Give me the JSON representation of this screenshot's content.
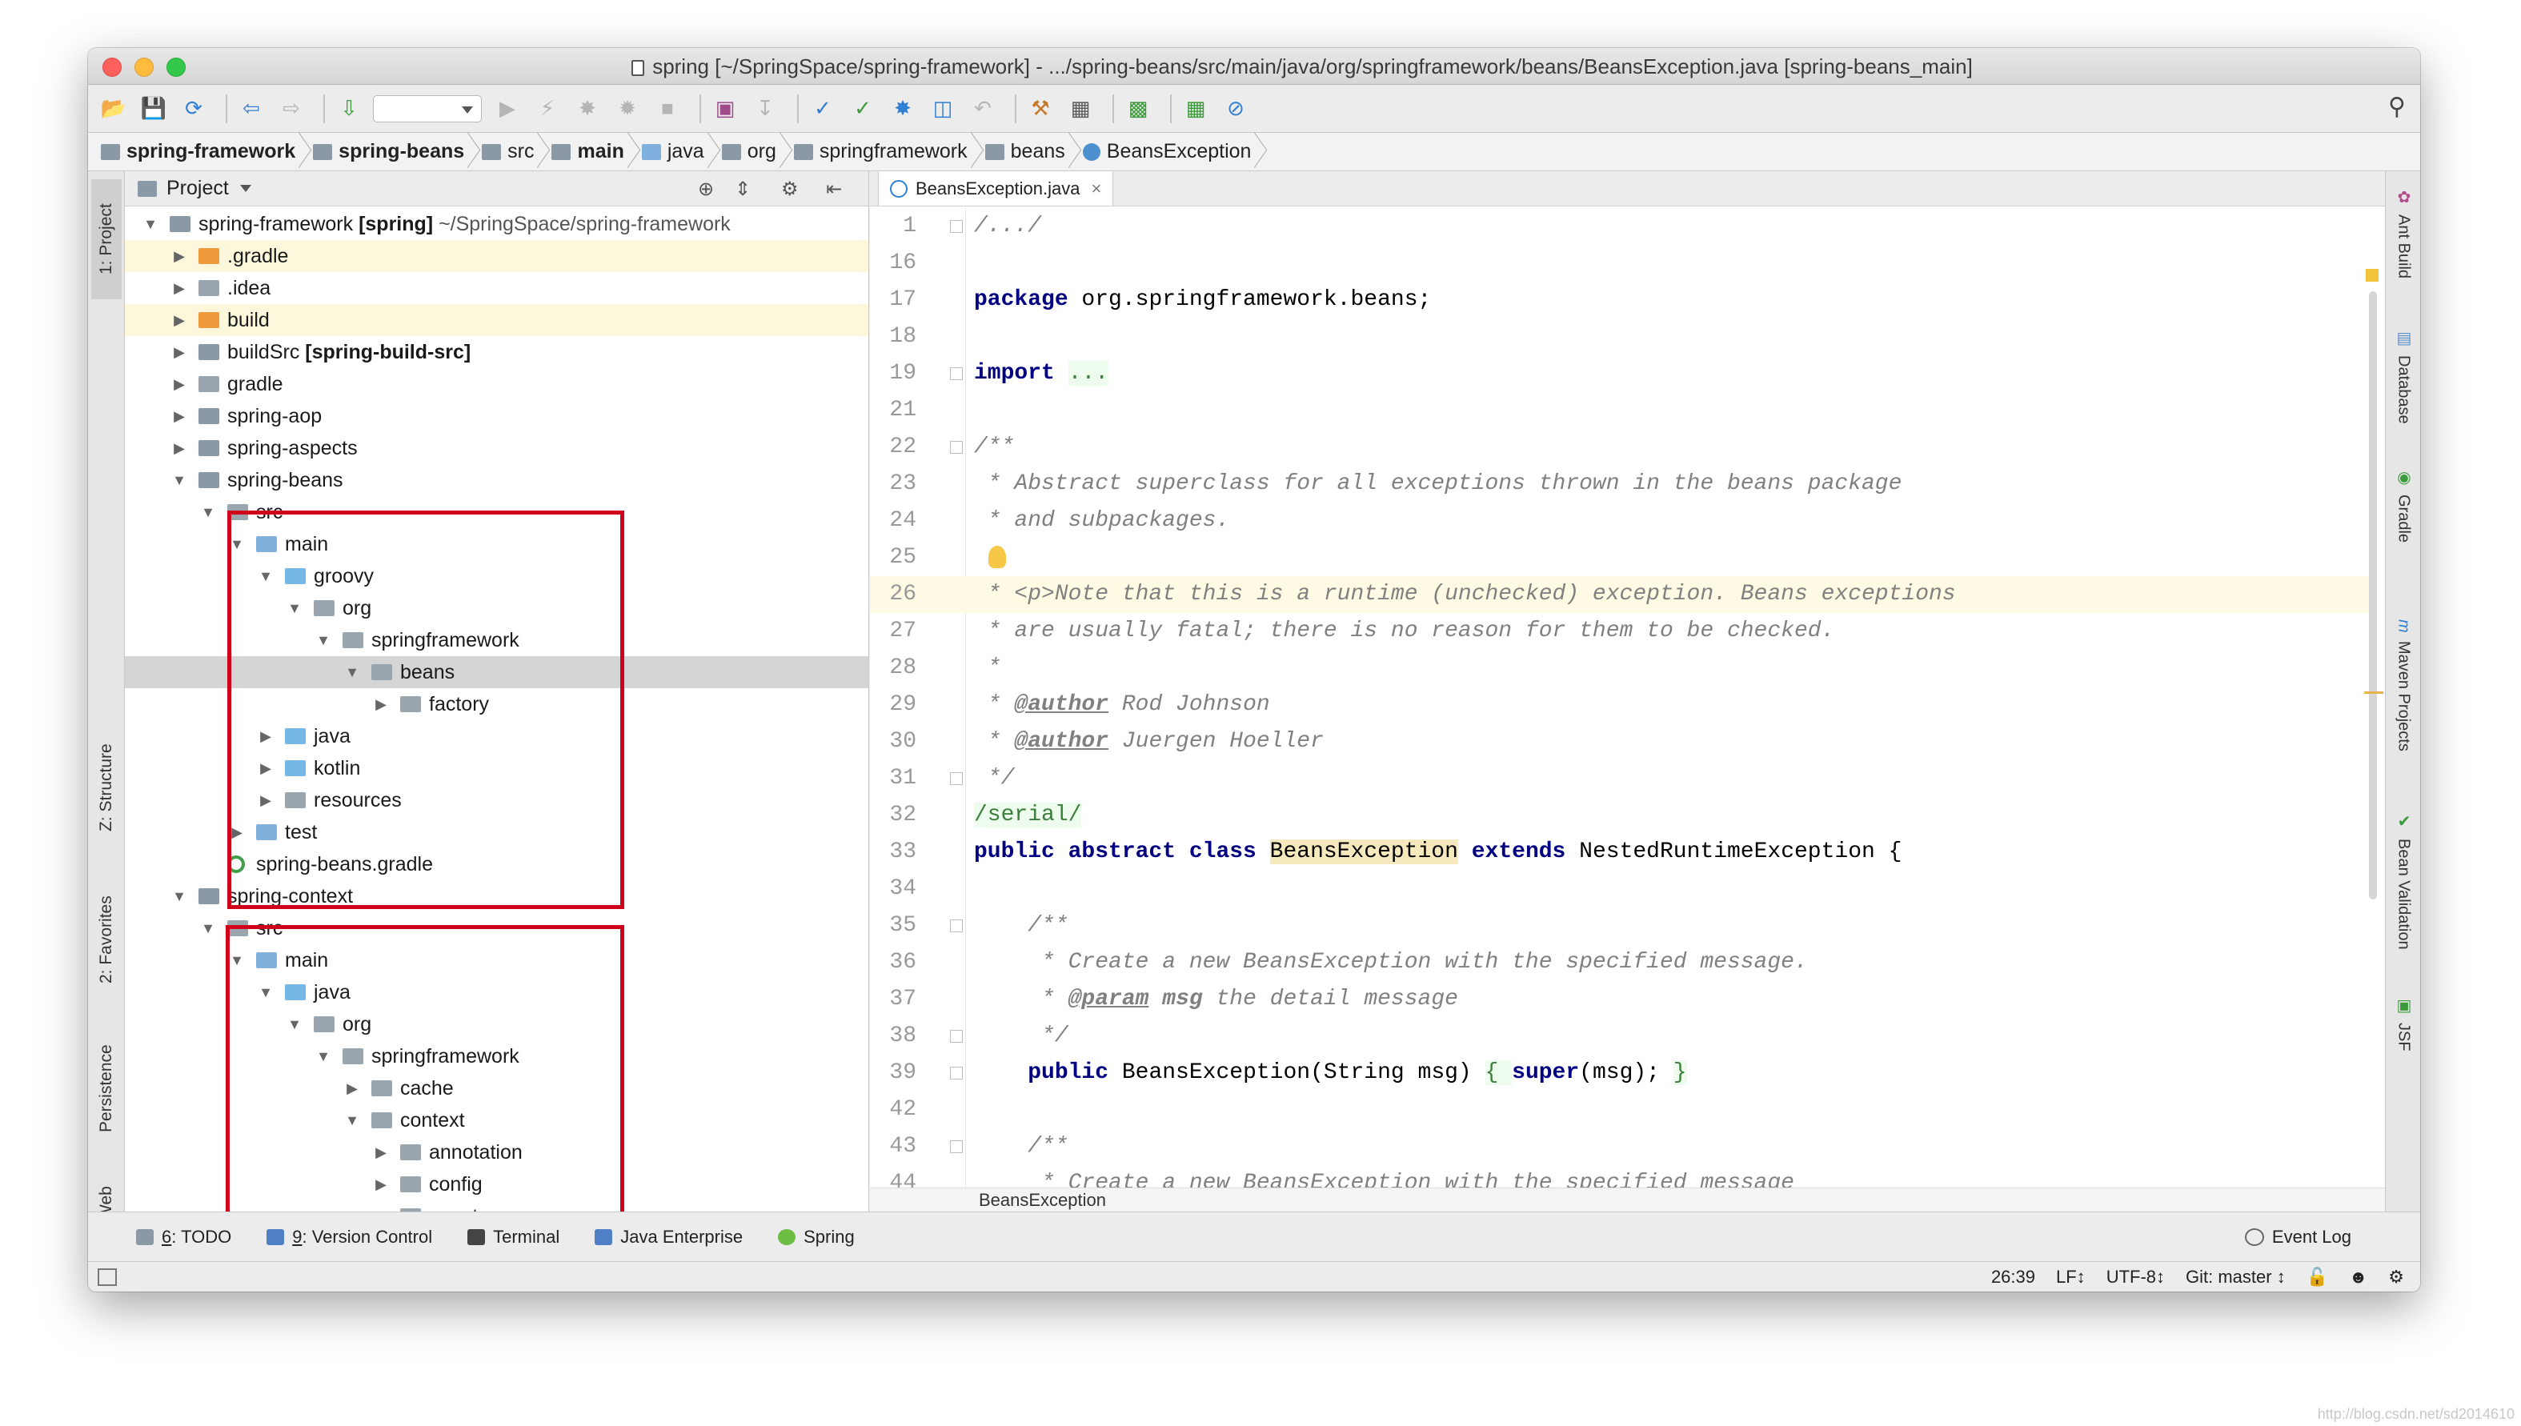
{
  "window": {
    "title": "spring [~/SpringSpace/spring-framework] - .../spring-beans/src/main/java/org/springframework/beans/BeansException.java [spring-beans_main]"
  },
  "toolbar": {
    "icons": [
      "open-folder-icon",
      "save-icon",
      "sync-icon",
      "back-icon",
      "forward-icon",
      "build-icon",
      "run-config-select",
      "run-icon",
      "run-debug-icon",
      "debug-icon",
      "coverage-icon",
      "stop-icon",
      "vcs-update-icon",
      "vcs-commit-icon",
      "vcs-branch-icon",
      "vcs-pull-icon",
      "vcs-push-icon",
      "vcs-compare-icon",
      "vcs-revert-icon",
      "project-structure-icon",
      "sdk-icon",
      "tasks-icon",
      "analyze-icon",
      "search-everywhere-icon"
    ]
  },
  "navbar": {
    "crumbs": [
      "spring-framework",
      "spring-beans",
      "src",
      "main",
      "java",
      "org",
      "springframework",
      "beans",
      "BeansException"
    ]
  },
  "left_strip": {
    "project": "1: Project",
    "structure": "Z: Structure",
    "favorites": "2: Favorites",
    "persistence": "Persistence",
    "web": "Web"
  },
  "right_strip": {
    "ant": "Ant Build",
    "database": "Database",
    "gradle": "Gradle",
    "maven": "Maven Projects",
    "bean_validation": "Bean Validation",
    "jsf": "JSF"
  },
  "project_panel": {
    "title": "Project",
    "tree": [
      {
        "label": "spring-framework",
        "bold": "[spring]",
        "extra": "~/SpringSpace/spring-framework",
        "depth": 0,
        "arrow": "down",
        "icon": "module"
      },
      {
        "label": ".gradle",
        "depth": 1,
        "arrow": "right",
        "icon": "orange",
        "hl": true
      },
      {
        "label": ".idea",
        "depth": 1,
        "arrow": "right",
        "icon": "folder"
      },
      {
        "label": "build",
        "depth": 1,
        "arrow": "right",
        "icon": "orange",
        "hl": true
      },
      {
        "label": "buildSrc",
        "bold": "[spring-build-src]",
        "depth": 1,
        "arrow": "right",
        "icon": "module"
      },
      {
        "label": "gradle",
        "depth": 1,
        "arrow": "right",
        "icon": "folder"
      },
      {
        "label": "spring-aop",
        "depth": 1,
        "arrow": "right",
        "icon": "module"
      },
      {
        "label": "spring-aspects",
        "depth": 1,
        "arrow": "right",
        "icon": "module"
      },
      {
        "label": "spring-beans",
        "depth": 1,
        "arrow": "down",
        "icon": "module"
      },
      {
        "label": "src",
        "depth": 2,
        "arrow": "down",
        "icon": "folder"
      },
      {
        "label": "main",
        "depth": 3,
        "arrow": "down",
        "icon": "src"
      },
      {
        "label": "groovy",
        "depth": 4,
        "arrow": "down",
        "icon": "blue"
      },
      {
        "label": "org",
        "depth": 5,
        "arrow": "down",
        "icon": "folder"
      },
      {
        "label": "springframework",
        "depth": 6,
        "arrow": "down",
        "icon": "folder"
      },
      {
        "label": "beans",
        "depth": 7,
        "arrow": "down",
        "icon": "folder",
        "selected": true
      },
      {
        "label": "factory",
        "depth": 8,
        "arrow": "right",
        "icon": "folder"
      },
      {
        "label": "java",
        "depth": 4,
        "arrow": "right",
        "icon": "blue"
      },
      {
        "label": "kotlin",
        "depth": 4,
        "arrow": "right",
        "icon": "blue"
      },
      {
        "label": "resources",
        "depth": 4,
        "arrow": "right",
        "icon": "folder"
      },
      {
        "label": "test",
        "depth": 3,
        "arrow": "right",
        "icon": "src"
      },
      {
        "label": "spring-beans.gradle",
        "depth": 2,
        "arrow": "",
        "icon": "gradle"
      },
      {
        "label": "spring-context",
        "depth": 1,
        "arrow": "down",
        "icon": "module"
      },
      {
        "label": "src",
        "depth": 2,
        "arrow": "down",
        "icon": "folder"
      },
      {
        "label": "main",
        "depth": 3,
        "arrow": "down",
        "icon": "src"
      },
      {
        "label": "java",
        "depth": 4,
        "arrow": "down",
        "icon": "blue"
      },
      {
        "label": "org",
        "depth": 5,
        "arrow": "down",
        "icon": "folder"
      },
      {
        "label": "springframework",
        "depth": 6,
        "arrow": "down",
        "icon": "folder"
      },
      {
        "label": "cache",
        "depth": 7,
        "arrow": "right",
        "icon": "folder"
      },
      {
        "label": "context",
        "depth": 7,
        "arrow": "down",
        "icon": "folder"
      },
      {
        "label": "annotation",
        "depth": 8,
        "arrow": "right",
        "icon": "folder"
      },
      {
        "label": "config",
        "depth": 8,
        "arrow": "right",
        "icon": "folder"
      },
      {
        "label": "event",
        "depth": 8,
        "arrow": "right",
        "icon": "folder"
      }
    ]
  },
  "editor": {
    "tab": "BeansException.java",
    "bottom_crumb": "BeansException",
    "lines": [
      {
        "n": "1",
        "parts": [
          [
            "cm",
            "/.../"
          ]
        ],
        "fold": true,
        "foldcls": "fold-mark"
      },
      {
        "n": "16",
        "parts": []
      },
      {
        "n": "17",
        "parts": [
          [
            "kw",
            "package"
          ],
          [
            "",
            " org.springframework.beans;"
          ]
        ]
      },
      {
        "n": "18",
        "parts": []
      },
      {
        "n": "19",
        "parts": [
          [
            "kw",
            "import"
          ],
          [
            "",
            " "
          ],
          [
            "fold-mark",
            "..."
          ]
        ],
        "fold": true
      },
      {
        "n": "21",
        "parts": []
      },
      {
        "n": "22",
        "parts": [
          [
            "cm",
            "/**"
          ]
        ],
        "fold": true
      },
      {
        "n": "23",
        "parts": [
          [
            "cm",
            " * Abstract superclass for all exceptions thrown in the beans package"
          ]
        ]
      },
      {
        "n": "24",
        "parts": [
          [
            "cm",
            " * and subpackages."
          ]
        ]
      },
      {
        "n": "25",
        "parts": [],
        "bulb": true
      },
      {
        "n": "26",
        "parts": [
          [
            "cm",
            " * <p>Note that this is a runtime (unchecked) exception. Beans exceptions"
          ]
        ],
        "current": true
      },
      {
        "n": "27",
        "parts": [
          [
            "cm",
            " * are usually fatal; there is no reason for them to be checked."
          ]
        ]
      },
      {
        "n": "28",
        "parts": [
          [
            "cm",
            " *"
          ]
        ]
      },
      {
        "n": "29",
        "parts": [
          [
            "cm",
            " * "
          ],
          [
            "tag",
            "@author"
          ],
          [
            "cm",
            " Rod Johnson"
          ]
        ]
      },
      {
        "n": "30",
        "parts": [
          [
            "cm",
            " * "
          ],
          [
            "tag",
            "@author"
          ],
          [
            "cm",
            " Juergen Hoeller"
          ]
        ]
      },
      {
        "n": "31",
        "parts": [
          [
            "cm",
            " */"
          ]
        ],
        "fold": true
      },
      {
        "n": "32",
        "parts": [
          [
            "fold-mark",
            "/serial/"
          ]
        ]
      },
      {
        "n": "33",
        "parts": [
          [
            "kw",
            "public abstract class"
          ],
          [
            "",
            " "
          ],
          [
            "cls-hl",
            "BeansException"
          ],
          [
            "",
            " "
          ],
          [
            "kw",
            "extends"
          ],
          [
            "",
            " NestedRuntimeException {"
          ]
        ]
      },
      {
        "n": "34",
        "parts": []
      },
      {
        "n": "35",
        "parts": [
          [
            "cm",
            "    /**"
          ]
        ],
        "fold": true
      },
      {
        "n": "36",
        "parts": [
          [
            "cm",
            "     * Create a new BeansException with the specified message."
          ]
        ]
      },
      {
        "n": "37",
        "parts": [
          [
            "cm",
            "     * "
          ],
          [
            "tag",
            "@param"
          ],
          [
            "cm",
            " "
          ],
          [
            "kwc",
            "msg"
          ],
          [
            "cm",
            " the detail message"
          ]
        ]
      },
      {
        "n": "38",
        "parts": [
          [
            "cm",
            "     */"
          ]
        ],
        "fold": true
      },
      {
        "n": "39",
        "parts": [
          [
            "",
            "    "
          ],
          [
            "kw",
            "public"
          ],
          [
            "",
            " BeansException(String msg) "
          ],
          [
            "fold-mark",
            "{ "
          ],
          [
            "kw",
            "super"
          ],
          [
            "",
            "(msg); "
          ],
          [
            "fold-mark",
            "}"
          ]
        ],
        "fold": true
      },
      {
        "n": "42",
        "parts": []
      },
      {
        "n": "43",
        "parts": [
          [
            "cm",
            "    /**"
          ]
        ],
        "fold": true
      },
      {
        "n": "44",
        "parts": [
          [
            "cm",
            "     * Create a new BeansException with the specified message"
          ]
        ]
      }
    ]
  },
  "bottom_tabs": {
    "todo_num": "6",
    "todo": ": TODO",
    "vc_num": "9",
    "vc": ": Version Control",
    "terminal": "Terminal",
    "java_enterprise": "Java Enterprise",
    "spring": "Spring",
    "event_log": "Event Log"
  },
  "status": {
    "position": "26:39",
    "line_sep": "LF↕",
    "encoding": "UTF-8↕",
    "git": "Git: master ↕"
  },
  "watermark": "http://blog.csdn.net/sd2014610"
}
